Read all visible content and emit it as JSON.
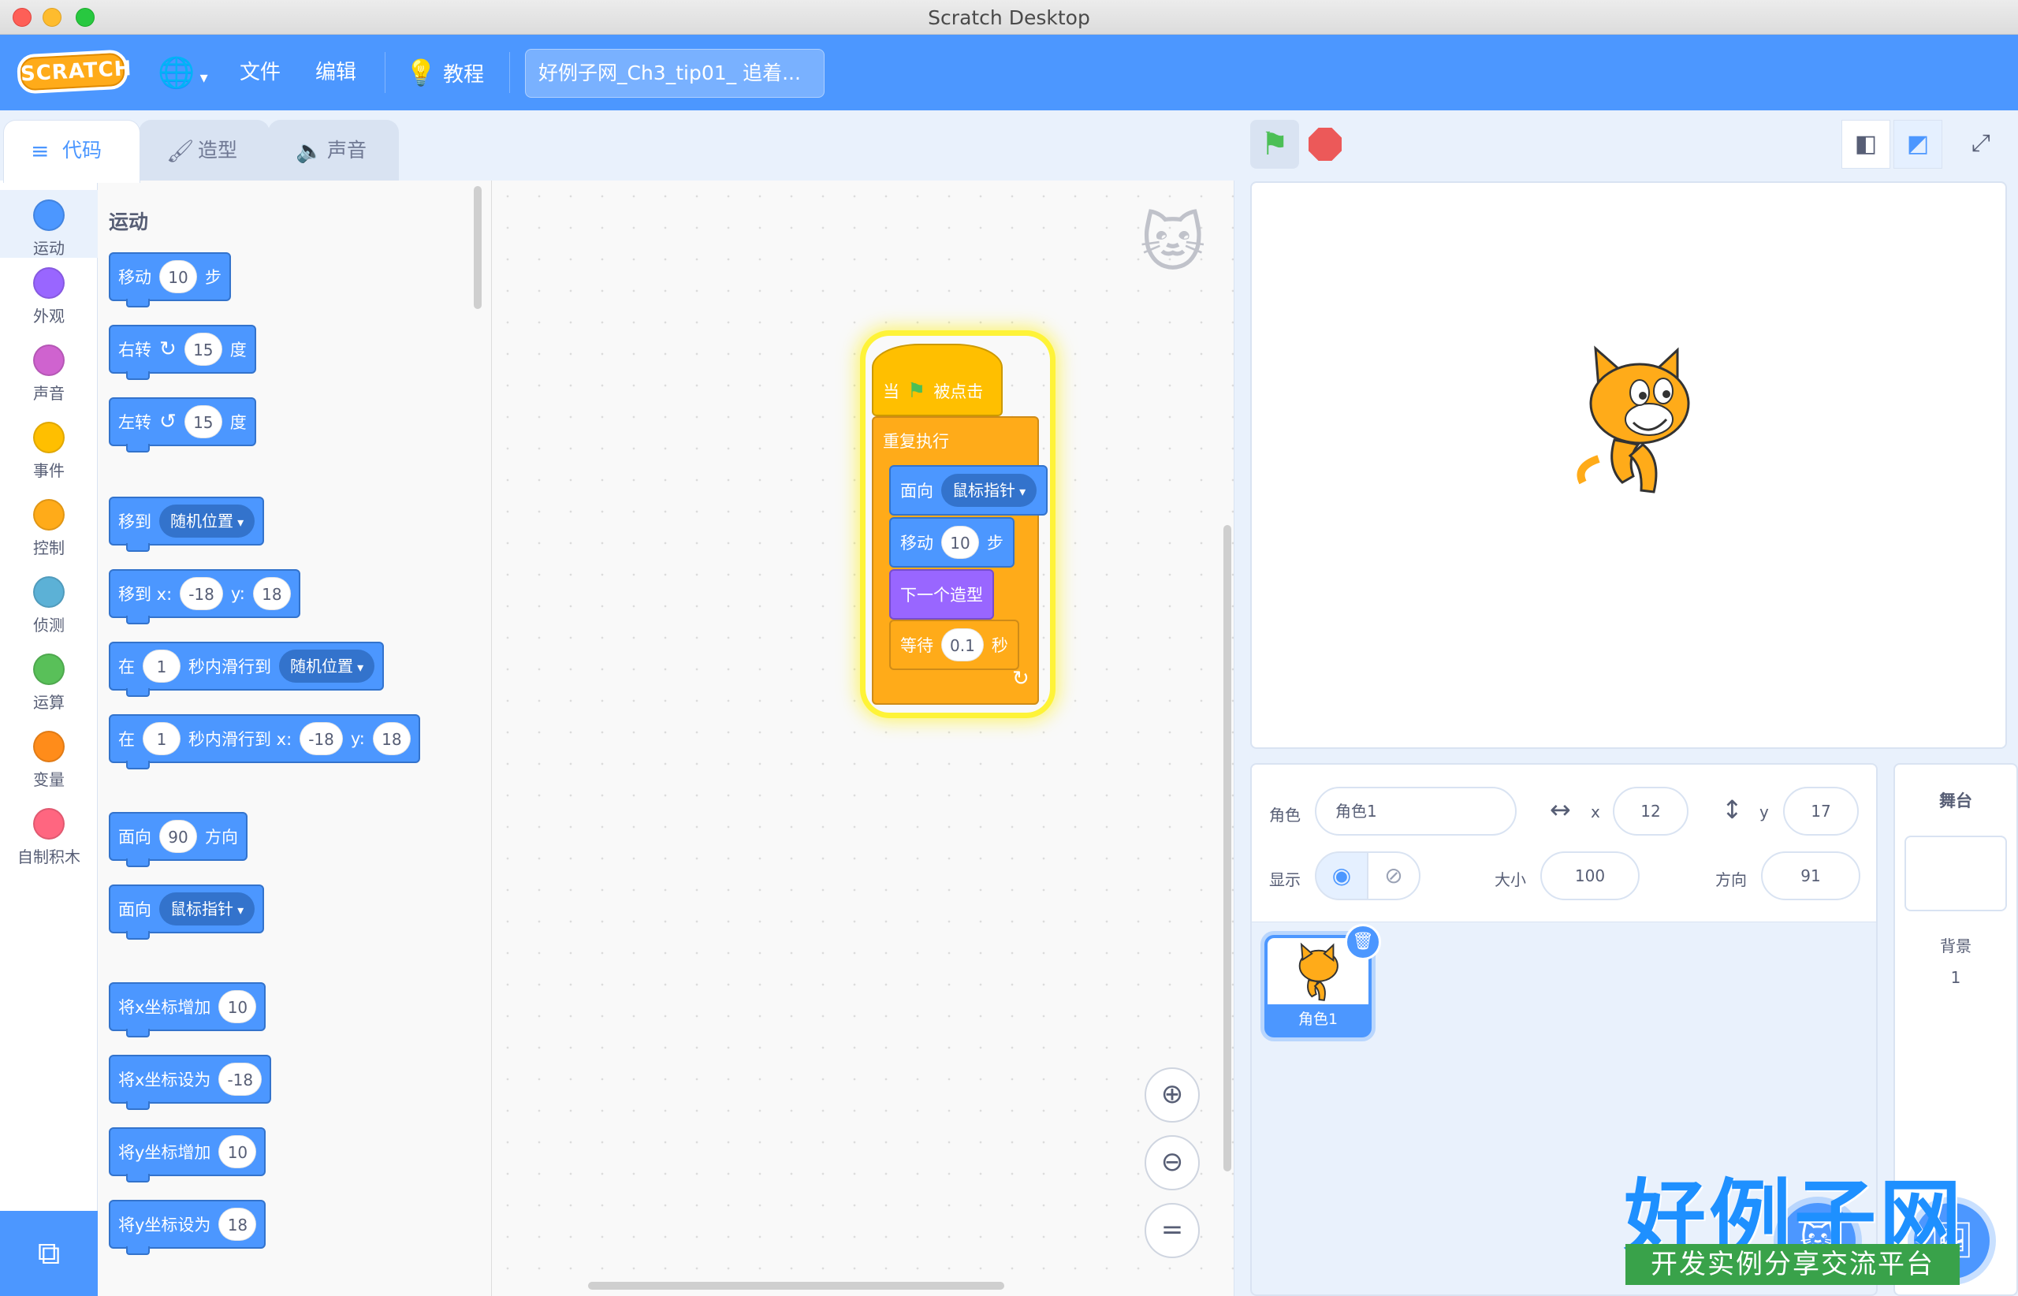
{
  "window": {
    "title": "Scratch Desktop"
  },
  "menubar": {
    "logo": "SCRATCH",
    "file": "文件",
    "edit": "编辑",
    "tutorials": "教程",
    "project_title": "好例子网_Ch3_tip01_ 追着..."
  },
  "tabs": {
    "code": "代码",
    "costumes": "造型",
    "sounds": "声音"
  },
  "categories": [
    {
      "label": "运动",
      "color": "#4c97ff"
    },
    {
      "label": "外观",
      "color": "#9966ff"
    },
    {
      "label": "声音",
      "color": "#cf63cf"
    },
    {
      "label": "事件",
      "color": "#ffbf00"
    },
    {
      "label": "控制",
      "color": "#ffab19"
    },
    {
      "label": "侦测",
      "color": "#5cb1d6"
    },
    {
      "label": "运算",
      "color": "#59c059"
    },
    {
      "label": "变量",
      "color": "#ff8c1a"
    },
    {
      "label": "自制积木",
      "color": "#ff6680"
    }
  ],
  "palette": {
    "heading": "运动",
    "move": {
      "a": "移动",
      "n": "10",
      "b": "步"
    },
    "turn_right": {
      "a": "右转",
      "n": "15",
      "b": "度"
    },
    "turn_left": {
      "a": "左转",
      "n": "15",
      "b": "度"
    },
    "goto": {
      "a": "移到",
      "d": "随机位置"
    },
    "goto_xy": {
      "a": "移到 x:",
      "x": "-18",
      "b": "y:",
      "y": "18"
    },
    "glide": {
      "a": "在",
      "n": "1",
      "b": "秒内滑行到",
      "d": "随机位置"
    },
    "glide_xy": {
      "a": "在",
      "n": "1",
      "b": "秒内滑行到 x:",
      "x": "-18",
      "c": "y:",
      "y": "18"
    },
    "point_dir": {
      "a": "面向",
      "n": "90",
      "b": "方向"
    },
    "point_towards": {
      "a": "面向",
      "d": "鼠标指针"
    },
    "change_x": {
      "a": "将x坐标增加",
      "n": "10"
    },
    "set_x": {
      "a": "将x坐标设为",
      "n": "-18"
    },
    "change_y": {
      "a": "将y坐标增加",
      "n": "10"
    },
    "set_y": {
      "a": "将y坐标设为",
      "n": "18"
    }
  },
  "script": {
    "hat_a": "当",
    "hat_b": "被点击",
    "forever": "重复执行",
    "point_a": "面向",
    "point_d": "鼠标指针",
    "move_a": "移动",
    "move_n": "10",
    "move_b": "步",
    "next_costume": "下一个造型",
    "wait_a": "等待",
    "wait_n": "0.1",
    "wait_b": "秒"
  },
  "sprite_info": {
    "sprite_label": "角色",
    "sprite_name": "角色1",
    "x_label": "x",
    "x": "12",
    "y_label": "y",
    "y": "17",
    "show_label": "显示",
    "size_label": "大小",
    "size": "100",
    "direction_label": "方向",
    "direction": "91"
  },
  "sprites": [
    {
      "name": "角色1"
    }
  ],
  "stage_pane": {
    "title": "舞台",
    "backdrops_label": "背景",
    "backdrops_count": "1"
  },
  "branding": {
    "big": "好例子网",
    "small": "开发实例分享交流平台"
  }
}
